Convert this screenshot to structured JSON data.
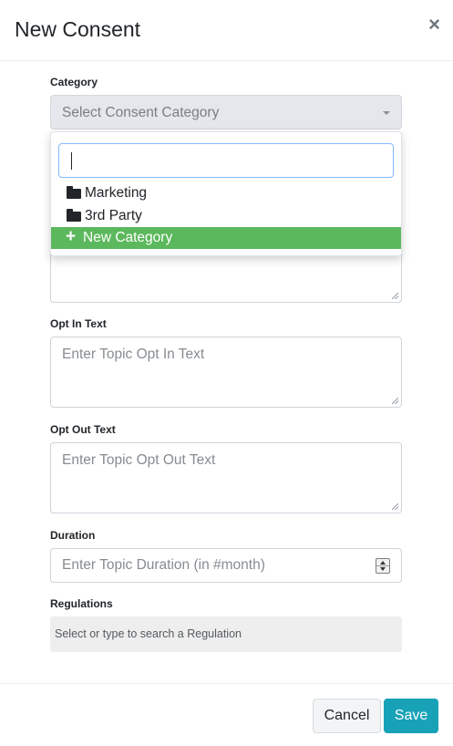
{
  "modal": {
    "title": "New Consent",
    "close_symbol": "×"
  },
  "form": {
    "category": {
      "label": "Category",
      "placeholder": "Select Consent Category",
      "dropdown": {
        "search_value": "",
        "options": [
          {
            "label": "Marketing",
            "icon": "folder-icon"
          },
          {
            "label": "3rd Party",
            "icon": "folder-icon"
          }
        ],
        "new_option": {
          "label": "New Category",
          "icon": "plus-icon",
          "highlight_color": "#5cb85c"
        }
      }
    },
    "opt_in": {
      "label": "Opt In Text",
      "placeholder": "Enter Topic Opt In Text"
    },
    "opt_out": {
      "label": "Opt Out Text",
      "placeholder": "Enter Topic Opt Out Text"
    },
    "duration": {
      "label": "Duration",
      "placeholder": "Enter Topic Duration (in #month)"
    },
    "regulations": {
      "label": "Regulations",
      "placeholder": "Select or type to search a Regulation"
    }
  },
  "footer": {
    "cancel_label": "Cancel",
    "save_label": "Save",
    "save_color": "#17a2b8"
  }
}
